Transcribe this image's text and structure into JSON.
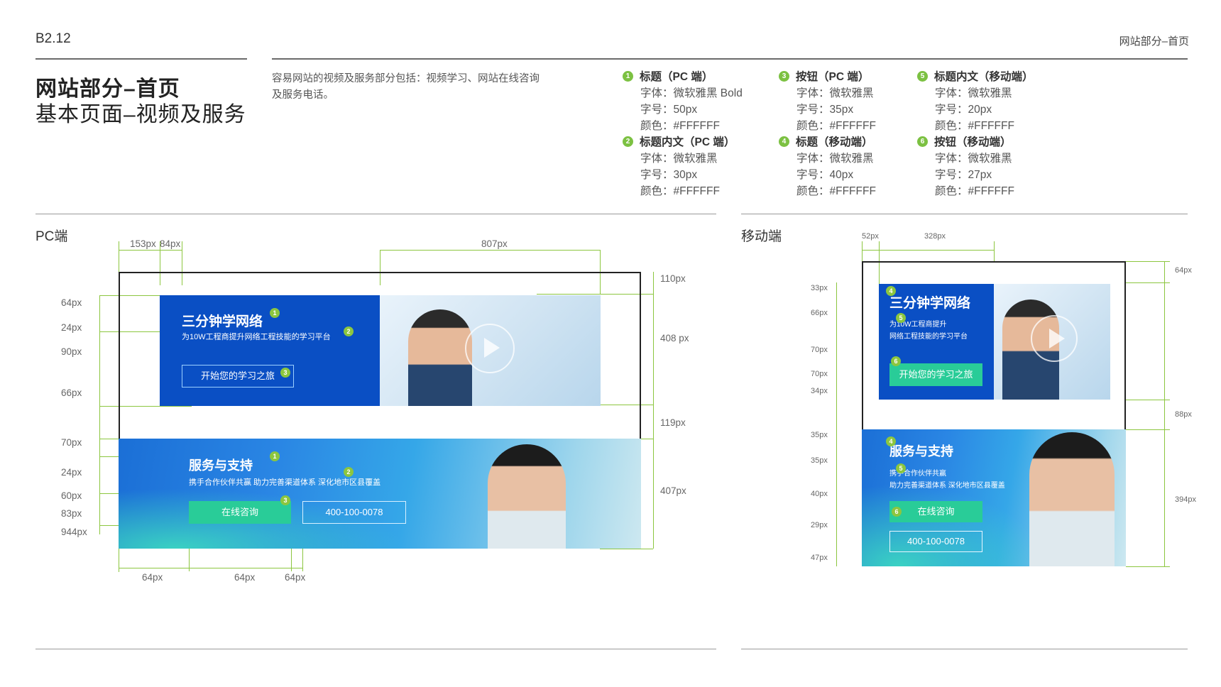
{
  "header": {
    "code": "B2.12",
    "right_label": "网站部分–首页"
  },
  "title": {
    "line1": "网站部分–首页",
    "line2": "基本页面–视频及服务"
  },
  "intro": {
    "line1": "容易网站的视频及服务部分包括：视频学习、网站在线咨询",
    "line2": "及服务电话。"
  },
  "specs": [
    {
      "num": "1",
      "head": "标题（PC 端）",
      "font": "字体：微软雅黑 Bold",
      "size": "字号：50px",
      "color": "颜色：#FFFFFF"
    },
    {
      "num": "2",
      "head": "标题内文（PC 端）",
      "font": "字体：微软雅黑",
      "size": "字号：30px",
      "color": "颜色：#FFFFFF"
    },
    {
      "num": "3",
      "head": "按钮（PC 端）",
      "font": "字体：微软雅黑",
      "size": "字号：35px",
      "color": "颜色：#FFFFFF"
    },
    {
      "num": "4",
      "head": "标题（移动端）",
      "font": "字体：微软雅黑",
      "size": "字号：40px",
      "color": "颜色：#FFFFFF"
    },
    {
      "num": "5",
      "head": "标题内文（移动端）",
      "font": "字体：微软雅黑",
      "size": "字号：20px",
      "color": "颜色：#FFFFFF"
    },
    {
      "num": "6",
      "head": "按钮（移动端）",
      "font": "字体：微软雅黑",
      "size": "字号：27px",
      "color": "颜色：#FFFFFF"
    }
  ],
  "pc": {
    "label": "PC端",
    "dims_top": [
      "153px",
      "84px",
      "807px"
    ],
    "dims_left": [
      "64px",
      "24px",
      "90px",
      "66px",
      "70px",
      "24px",
      "60px",
      "83px",
      "944px"
    ],
    "dims_right": [
      "110px",
      "408 px",
      "119px",
      "407px"
    ],
    "dims_bottom": [
      "64px",
      "64px",
      "64px"
    ],
    "video": {
      "title": "三分钟学网络",
      "subtitle": "为10W工程商提升网络工程技能的学习平台",
      "button": "开始您的学习之旅"
    },
    "service": {
      "title": "服务与支持",
      "subtitle": "携手合作伙伴共赢 助力完善渠道体系 深化地市区县覆盖",
      "consult": "在线咨询",
      "phone": "400-100-0078"
    },
    "markers": [
      "1",
      "2",
      "3",
      "1",
      "2",
      "3"
    ]
  },
  "mobile": {
    "label": "移动端",
    "dims_top": [
      "52px",
      "328px"
    ],
    "dims_left": [
      "33px",
      "66px",
      "70px",
      "70px",
      "34px",
      "35px",
      "35px",
      "40px",
      "29px",
      "47px"
    ],
    "dims_right": [
      "64px",
      "88px",
      "394px"
    ],
    "video": {
      "title": "三分钟学网络",
      "subtitle1": "为10W工程商提升",
      "subtitle2": "网络工程技能的学习平台",
      "button": "开始您的学习之旅"
    },
    "service": {
      "title": "服务与支持",
      "subtitle1": "携手合作伙伴共赢",
      "subtitle2": "助力完善渠道体系 深化地市区县覆盖",
      "consult": "在线咨询",
      "phone": "400-100-0078"
    },
    "markers": [
      "4",
      "5",
      "6",
      "4",
      "5",
      "6"
    ]
  },
  "colors": {
    "accent_green": "#8cc63f",
    "brand_blue": "#0a4fc4",
    "button_green": "#29cc98"
  }
}
